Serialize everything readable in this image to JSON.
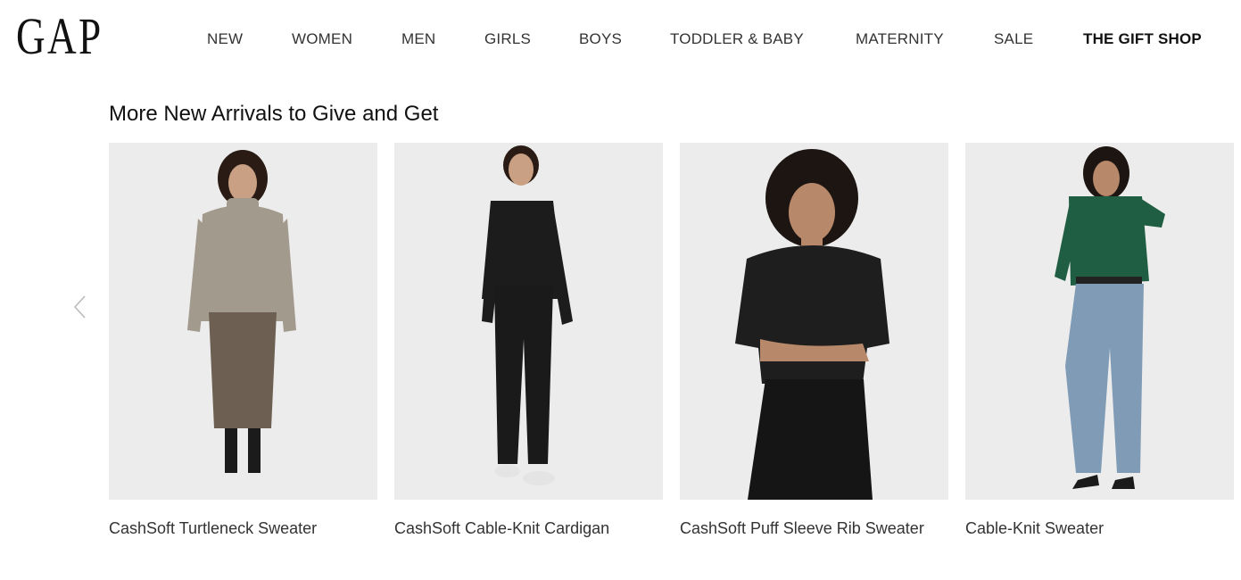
{
  "brand": {
    "logo_text": "GAP"
  },
  "nav": {
    "items": [
      {
        "label": "NEW"
      },
      {
        "label": "WOMEN"
      },
      {
        "label": "MEN"
      },
      {
        "label": "GIRLS"
      },
      {
        "label": "BOYS"
      },
      {
        "label": "TODDLER & BABY"
      },
      {
        "label": "MATERNITY"
      },
      {
        "label": "SALE"
      },
      {
        "label": "THE GIFT SHOP"
      }
    ]
  },
  "section": {
    "title": "More New Arrivals to Give and Get"
  },
  "carousel": {
    "prev_icon": "chevron-left-icon"
  },
  "products": [
    {
      "name": "CashSoft Turtleneck Sweater",
      "top_color": "#a39a8e",
      "bottom_color": "#6d6052"
    },
    {
      "name": "CashSoft Cable-Knit Cardigan",
      "top_color": "#1c1c1c",
      "bottom_color": "#1a1a1a"
    },
    {
      "name": "CashSoft Puff Sleeve Rib Sweater",
      "top_color": "#1e1e1e",
      "bottom_color": "#151515"
    },
    {
      "name": "Cable-Knit Sweater",
      "top_color": "#1f5e42",
      "bottom_color": "#7f9bb5"
    }
  ],
  "colors": {
    "image_bg": "#ececec",
    "skin": "#c9a083",
    "hair": "#2a1c14"
  }
}
